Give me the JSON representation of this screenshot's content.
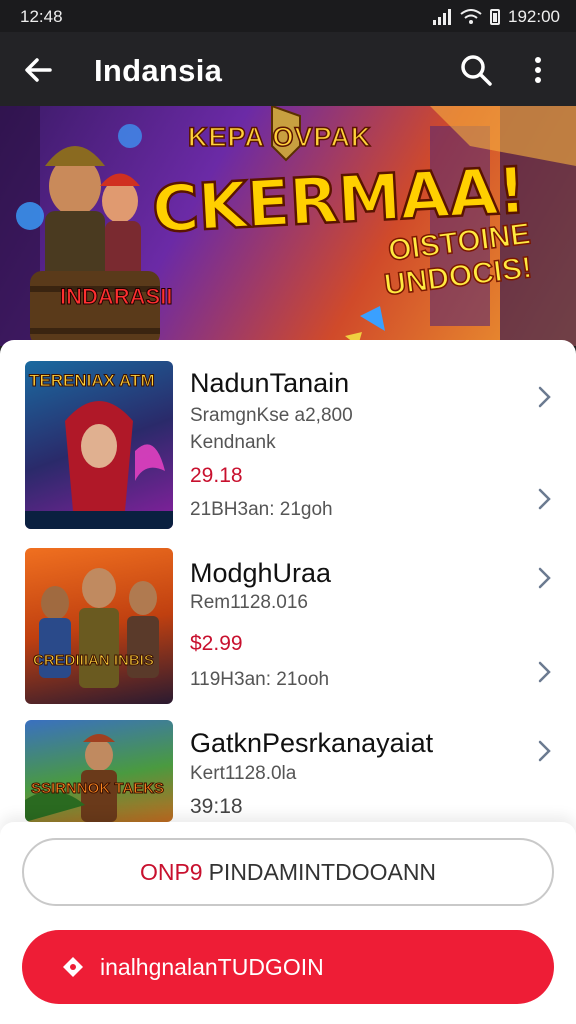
{
  "status_bar": {
    "time": "12:48",
    "right_text": "ᑕ6 ⁝  ⅞ 192:00",
    "clock": "192:00"
  },
  "appbar": {
    "title": "Indansia"
  },
  "banner": {
    "top_text": "KEPA OVPAK",
    "main_text": "CKERMAA!",
    "sub_line1": "OISTOINE",
    "sub_line2": "UNDOCIS!",
    "barrel_text": "INDARASII"
  },
  "items": [
    {
      "name": "NadunTanain",
      "line1": "SramgnKse a2,800",
      "line2": "Kendnank",
      "price": "29.18",
      "line4": "21BH3an: 21goh",
      "thumb_text": "TERENIAX ATM"
    },
    {
      "name": "ModghUraa",
      "line1": "Rem1128.016",
      "price": "$2.99",
      "line4": "119H3an: 21ooh",
      "thumb_text": "CREDIIIAN INBIS"
    },
    {
      "name": "GatknPesrkanayaiat",
      "line1": "Kert1128.0la",
      "price": "39:18",
      "thumb_text": "SSIRNNOK TAEKS"
    }
  ],
  "buttons": {
    "outline_highlight": "ONP9",
    "outline_label": "PINDAMINTDOOANN",
    "primary_label": "inalhgnalanTUDGOIN"
  },
  "colors": {
    "accent_red": "#ee1d36",
    "price_red": "#c8102e",
    "appbar": "#232326"
  }
}
